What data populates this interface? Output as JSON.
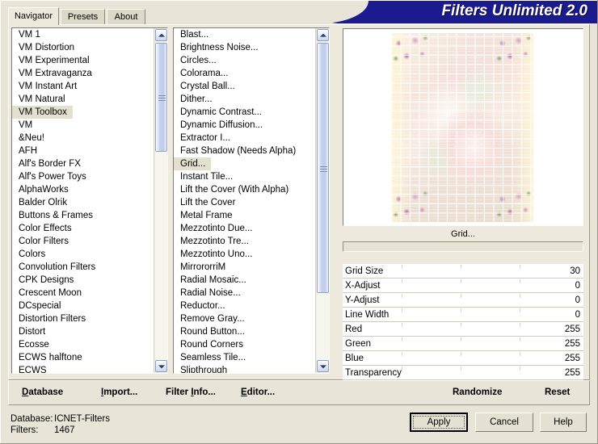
{
  "window": {
    "title": "Filters Unlimited 2.0",
    "title_color": "#1b1b8f"
  },
  "tabs": [
    {
      "label": "Navigator",
      "active": true
    },
    {
      "label": "Presets",
      "active": false
    },
    {
      "label": "About",
      "active": false
    }
  ],
  "categories": {
    "selected": "VM Toolbox",
    "items": [
      "VM 1",
      "VM Distortion",
      "VM Experimental",
      "VM Extravaganza",
      "VM Instant Art",
      "VM Natural",
      "VM Toolbox",
      "VM",
      "&Neu!",
      "AFH",
      "Alf's Border FX",
      "Alf's Power Toys",
      "AlphaWorks",
      "Balder Olrik",
      "Buttons & Frames",
      "Color Effects",
      "Color Filters",
      "Colors",
      "Convolution Filters",
      "CPK Designs",
      "Crescent Moon",
      "DCspecial",
      "Distortion Filters",
      "Distort",
      "Ecosse",
      "ECWS halftone",
      "ECWS"
    ]
  },
  "filters": {
    "selected": "Grid...",
    "items": [
      "Blast...",
      "Brightness Noise...",
      "Circles...",
      "Colorama...",
      "Crystal Ball...",
      "Dither...",
      "Dynamic Contrast...",
      "Dynamic Diffusion...",
      "Extractor I...",
      "Fast Shadow (Needs Alpha)",
      "Grid...",
      "Instant Tile...",
      "Lift the Cover (With Alpha)",
      "Lift the Cover",
      "Metal Frame",
      "Mezzotinto Due...",
      "Mezzotinto Tre...",
      "Mezzotinto Uno...",
      "MirrororriM",
      "Radial Mosaic...",
      "Radial Noise...",
      "Reductor...",
      "Remove Gray...",
      "Round Button...",
      "Round Corners",
      "Seamless Tile...",
      "Slipthrough"
    ]
  },
  "preview": {
    "caption": "Grid...",
    "progress_percent": 0
  },
  "parameters": [
    {
      "name": "Grid Size",
      "value": "30"
    },
    {
      "name": "X-Adjust",
      "value": "0"
    },
    {
      "name": "Y-Adjust",
      "value": "0"
    },
    {
      "name": "Line Width",
      "value": "0"
    },
    {
      "name": "Red",
      "value": "255"
    },
    {
      "name": "Green",
      "value": "255"
    },
    {
      "name": "Blue",
      "value": "255"
    },
    {
      "name": "Transparency",
      "value": "255"
    }
  ],
  "commands": {
    "database": "Database",
    "import": "Import...",
    "filter_info": "Filter Info...",
    "editor": "Editor...",
    "randomize": "Randomize",
    "reset": "Reset"
  },
  "status": {
    "database_label": "Database:",
    "database_value": "ICNET-Filters",
    "filters_label": "Filters:",
    "filters_value": "1467"
  },
  "buttons": {
    "apply": "Apply",
    "cancel": "Cancel",
    "help": "Help"
  }
}
